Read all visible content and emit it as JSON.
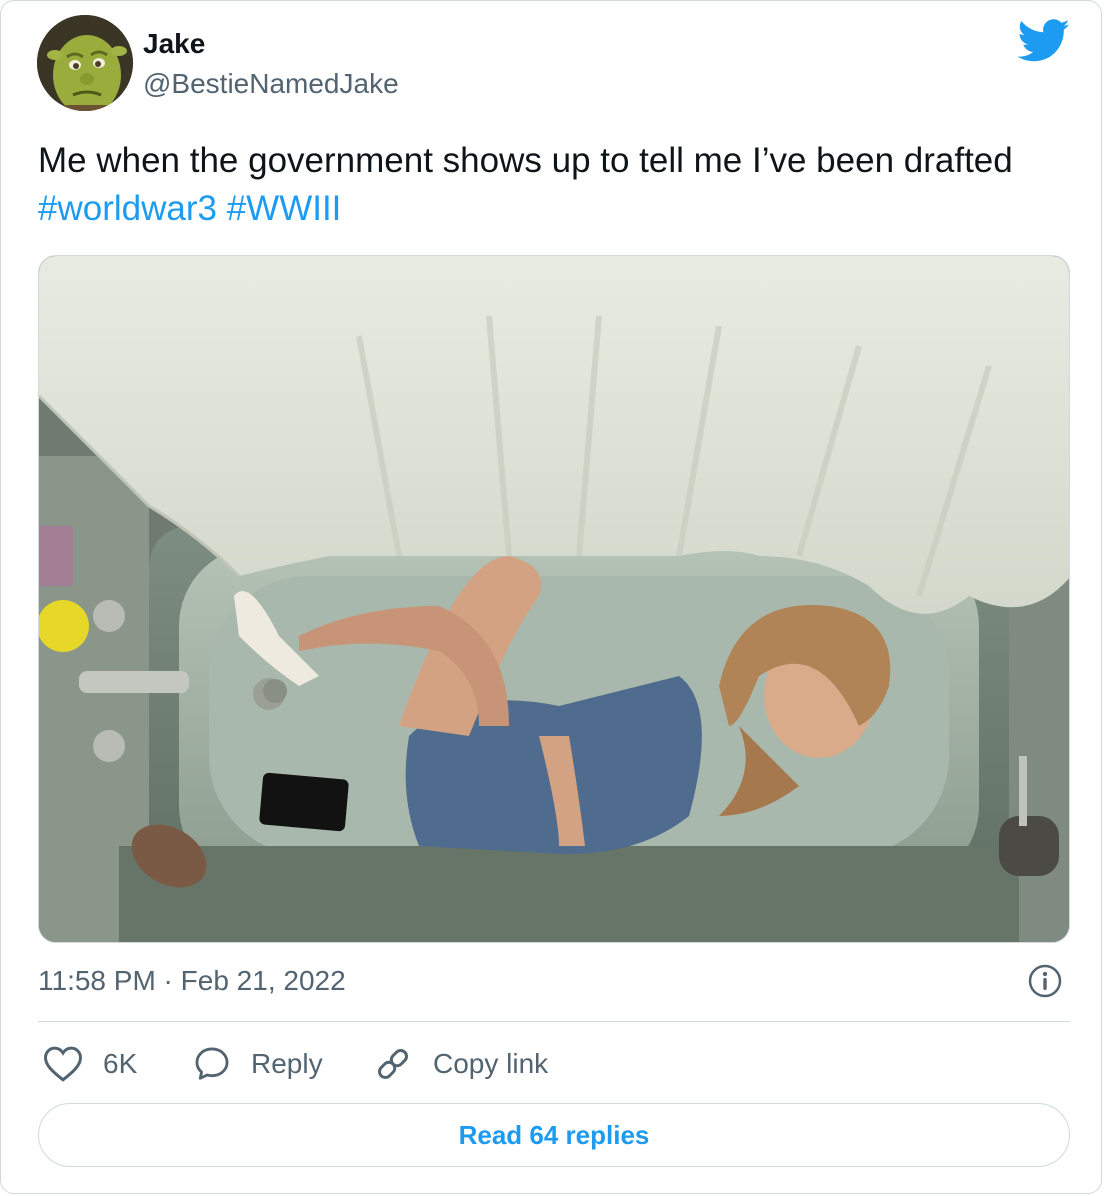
{
  "author": {
    "display_name": "Jake",
    "handle": "@BestieNamedJake",
    "avatar_icon": "shrek-avatar"
  },
  "tweet": {
    "text": "Me when the government shows up to tell me I’ve been drafted",
    "hashtags": [
      "#worldwar3",
      "#WWIII"
    ],
    "timestamp": "11:58 PM · Feb 21, 2022"
  },
  "actions": {
    "like_count": "6K",
    "reply_label": "Reply",
    "copy_link_label": "Copy link"
  },
  "read_replies_label": "Read 64 replies",
  "colors": {
    "accent": "#1d9bf0",
    "text": "#0f1419",
    "secondary_text": "#536471",
    "border": "#cfd9de"
  },
  "icons": {
    "brand": "twitter-bird-icon",
    "info": "info-icon",
    "like": "heart-icon",
    "reply": "speech-bubble-icon",
    "copy": "link-icon"
  }
}
